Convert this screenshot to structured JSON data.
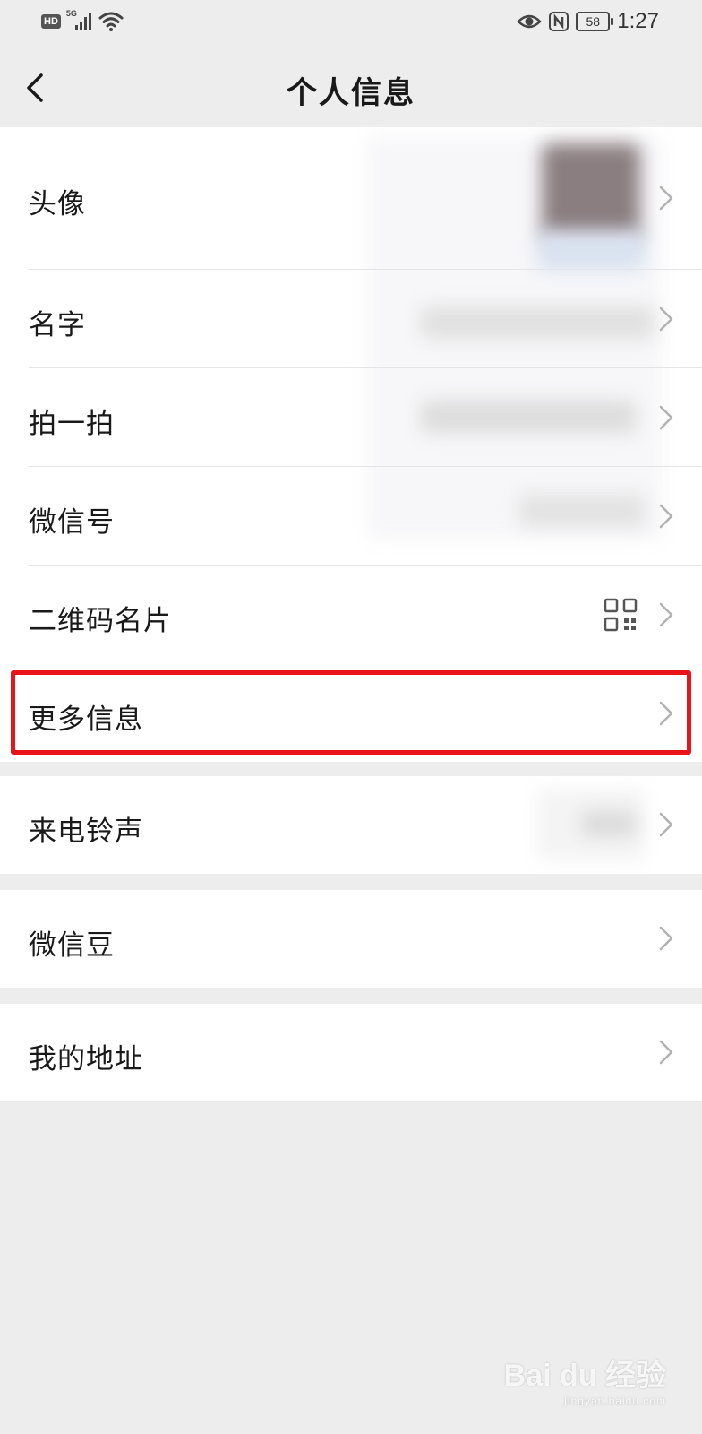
{
  "status_bar": {
    "hd": "HD",
    "network": "5G",
    "battery": "58",
    "time": "1:27",
    "icons": [
      "hd-icon",
      "signal-icon",
      "wifi-icon",
      "eye-icon",
      "nfc-icon",
      "battery-icon"
    ]
  },
  "nav": {
    "title": "个人信息",
    "back_icon": "chevron-left-icon"
  },
  "profile_rows": [
    {
      "label": "头像"
    },
    {
      "label": "名字"
    },
    {
      "label": "拍一拍"
    },
    {
      "label": "微信号"
    },
    {
      "label": "二维码名片"
    },
    {
      "label": "更多信息"
    }
  ],
  "ringtone_row": {
    "label": "来电铃声"
  },
  "beans_row": {
    "label": "微信豆"
  },
  "address_row": {
    "label": "我的地址"
  },
  "highlight_color": "#e8141a",
  "watermark": {
    "main": "Bai du 经验",
    "sub": "jingyan.baidu.com"
  }
}
